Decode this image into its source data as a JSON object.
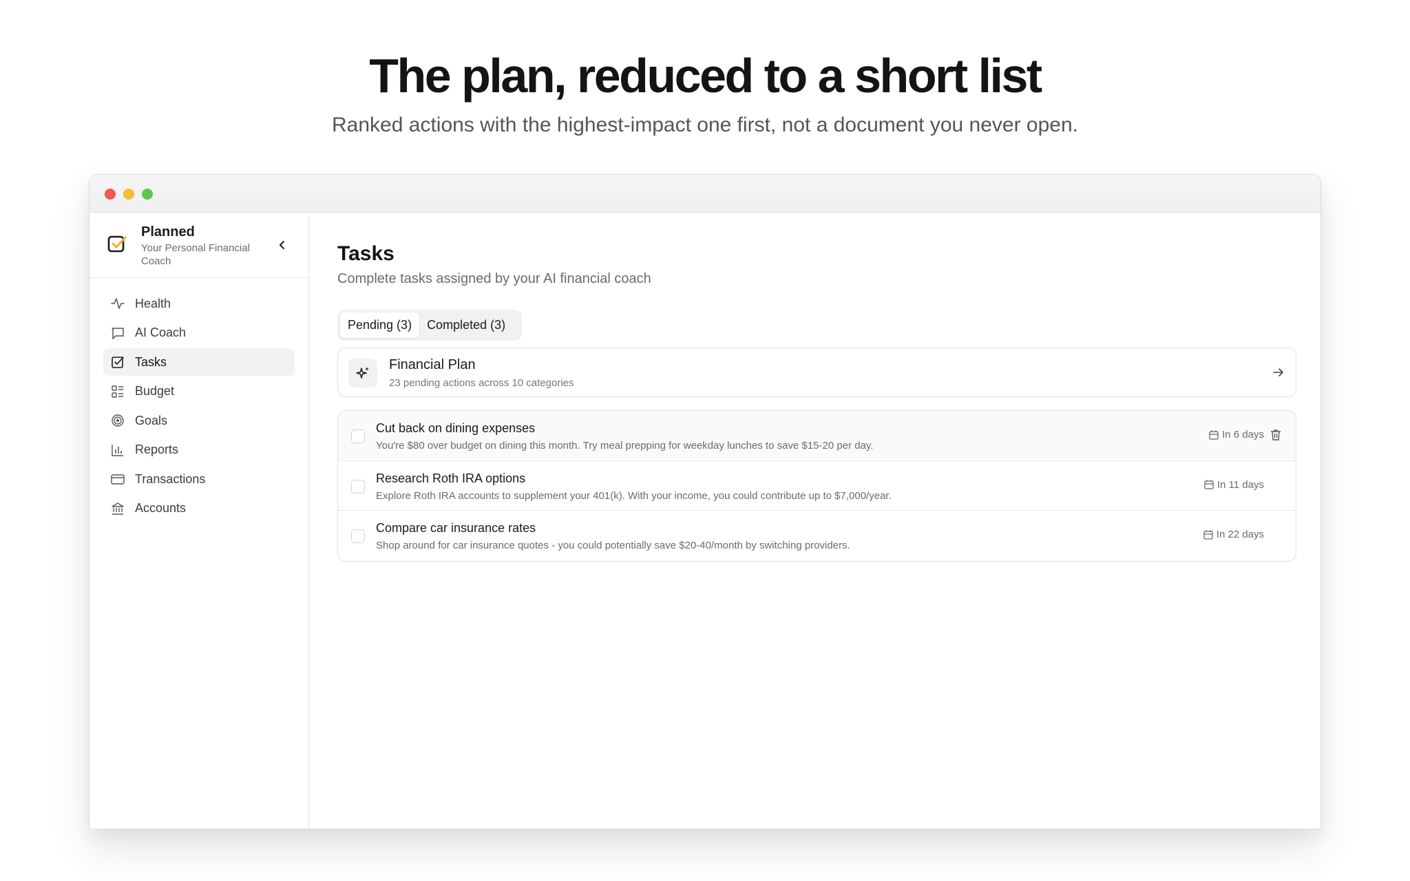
{
  "hero": {
    "title": "The plan, reduced to a short list",
    "subtitle": "Ranked actions with the highest-impact one first, not a document you never open."
  },
  "brand": {
    "name": "Planned",
    "tagline": "Your Personal Financial Coach",
    "accent_color": "#f2b632"
  },
  "sidebar": {
    "items": [
      {
        "label": "Health",
        "icon": "activity-icon"
      },
      {
        "label": "AI Coach",
        "icon": "chat-icon"
      },
      {
        "label": "Tasks",
        "icon": "checkbox-icon",
        "active": true
      },
      {
        "label": "Budget",
        "icon": "list-icon"
      },
      {
        "label": "Goals",
        "icon": "target-icon"
      },
      {
        "label": "Reports",
        "icon": "bar-chart-icon"
      },
      {
        "label": "Transactions",
        "icon": "card-icon"
      },
      {
        "label": "Accounts",
        "icon": "bank-icon"
      }
    ]
  },
  "page": {
    "title": "Tasks",
    "subtitle": "Complete tasks assigned by your AI financial coach"
  },
  "tabs": [
    {
      "label": "Pending (3)",
      "active": true
    },
    {
      "label": "Completed (3)",
      "active": false
    }
  ],
  "plan": {
    "title": "Financial Plan",
    "subtitle": "23 pending actions across 10 categories"
  },
  "tasks": [
    {
      "title": "Cut back on dining expenses",
      "description": "You're $80 over budget on dining this month. Try meal prepping for weekday lunches to save $15-20 per day.",
      "due": "In 6 days"
    },
    {
      "title": "Research Roth IRA options",
      "description": "Explore Roth IRA accounts to supplement your 401(k). With your income, you could contribute up to $7,000/year.",
      "due": "In 11 days"
    },
    {
      "title": "Compare car insurance rates",
      "description": "Shop around for car insurance quotes - you could potentially save $20-40/month by switching providers.",
      "due": "In 22 days"
    }
  ]
}
